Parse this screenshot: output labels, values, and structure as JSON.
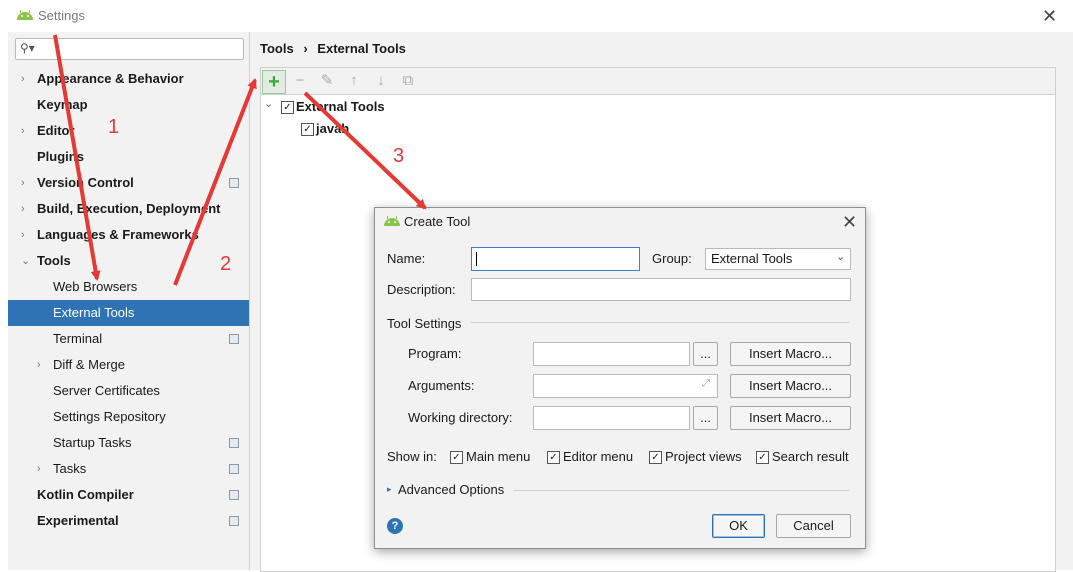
{
  "window": {
    "title": "Settings"
  },
  "search": {
    "placeholder": ""
  },
  "sidebar": {
    "items": [
      {
        "label": "Appearance & Behavior",
        "bold": true,
        "arrow": "right",
        "level": 0,
        "proj": false
      },
      {
        "label": "Keymap",
        "bold": true,
        "arrow": "",
        "level": 0,
        "proj": false
      },
      {
        "label": "Editor",
        "bold": true,
        "arrow": "right",
        "level": 0,
        "proj": false
      },
      {
        "label": "Plugins",
        "bold": true,
        "arrow": "",
        "level": 0,
        "proj": false
      },
      {
        "label": "Version Control",
        "bold": true,
        "arrow": "right",
        "level": 0,
        "proj": true
      },
      {
        "label": "Build, Execution, Deployment",
        "bold": true,
        "arrow": "right",
        "level": 0,
        "proj": false
      },
      {
        "label": "Languages & Frameworks",
        "bold": true,
        "arrow": "right",
        "level": 0,
        "proj": false
      },
      {
        "label": "Tools",
        "bold": true,
        "arrow": "down",
        "level": 0,
        "proj": false
      },
      {
        "label": "Web Browsers",
        "bold": false,
        "arrow": "",
        "level": 1,
        "proj": false
      },
      {
        "label": "External Tools",
        "bold": false,
        "arrow": "",
        "level": 1,
        "proj": false,
        "selected": true
      },
      {
        "label": "Terminal",
        "bold": false,
        "arrow": "",
        "level": 1,
        "proj": true
      },
      {
        "label": "Diff & Merge",
        "bold": false,
        "arrow": "right",
        "level": 1,
        "proj": false
      },
      {
        "label": "Server Certificates",
        "bold": false,
        "arrow": "",
        "level": 1,
        "proj": false
      },
      {
        "label": "Settings Repository",
        "bold": false,
        "arrow": "",
        "level": 1,
        "proj": false
      },
      {
        "label": "Startup Tasks",
        "bold": false,
        "arrow": "",
        "level": 1,
        "proj": true
      },
      {
        "label": "Tasks",
        "bold": false,
        "arrow": "right",
        "level": 1,
        "proj": true
      },
      {
        "label": "Kotlin Compiler",
        "bold": true,
        "arrow": "",
        "level": 0,
        "proj": true
      },
      {
        "label": "Experimental",
        "bold": true,
        "arrow": "",
        "level": 0,
        "proj": true
      }
    ]
  },
  "breadcrumb": {
    "parent": "Tools",
    "separator": "›",
    "current": "External Tools"
  },
  "toolbar": {
    "add": "+",
    "remove": "−",
    "edit": "✎",
    "up": "↑",
    "down": "↓",
    "copy": "⧉"
  },
  "tree": {
    "group": "External Tools",
    "tool": "javah"
  },
  "dialog": {
    "title": "Create Tool",
    "name_label": "Name:",
    "group_label": "Group:",
    "group_value": "External Tools",
    "description_label": "Description:",
    "tool_settings_label": "Tool Settings",
    "program_label": "Program:",
    "arguments_label": "Arguments:",
    "workdir_label": "Working directory:",
    "browse": "...",
    "insert_macro": "Insert Macro...",
    "show_in_label": "Show in:",
    "show_in": [
      "Main menu",
      "Editor menu",
      "Project views",
      "Search result"
    ],
    "advanced": "Advanced Options",
    "ok": "OK",
    "cancel": "Cancel",
    "help": "?"
  },
  "annotations": {
    "n1": "1",
    "n2": "2",
    "n3": "3"
  },
  "colors": {
    "accent": "#2f73b4",
    "arrow_red": "#e53935",
    "add_green": "#39a839"
  }
}
